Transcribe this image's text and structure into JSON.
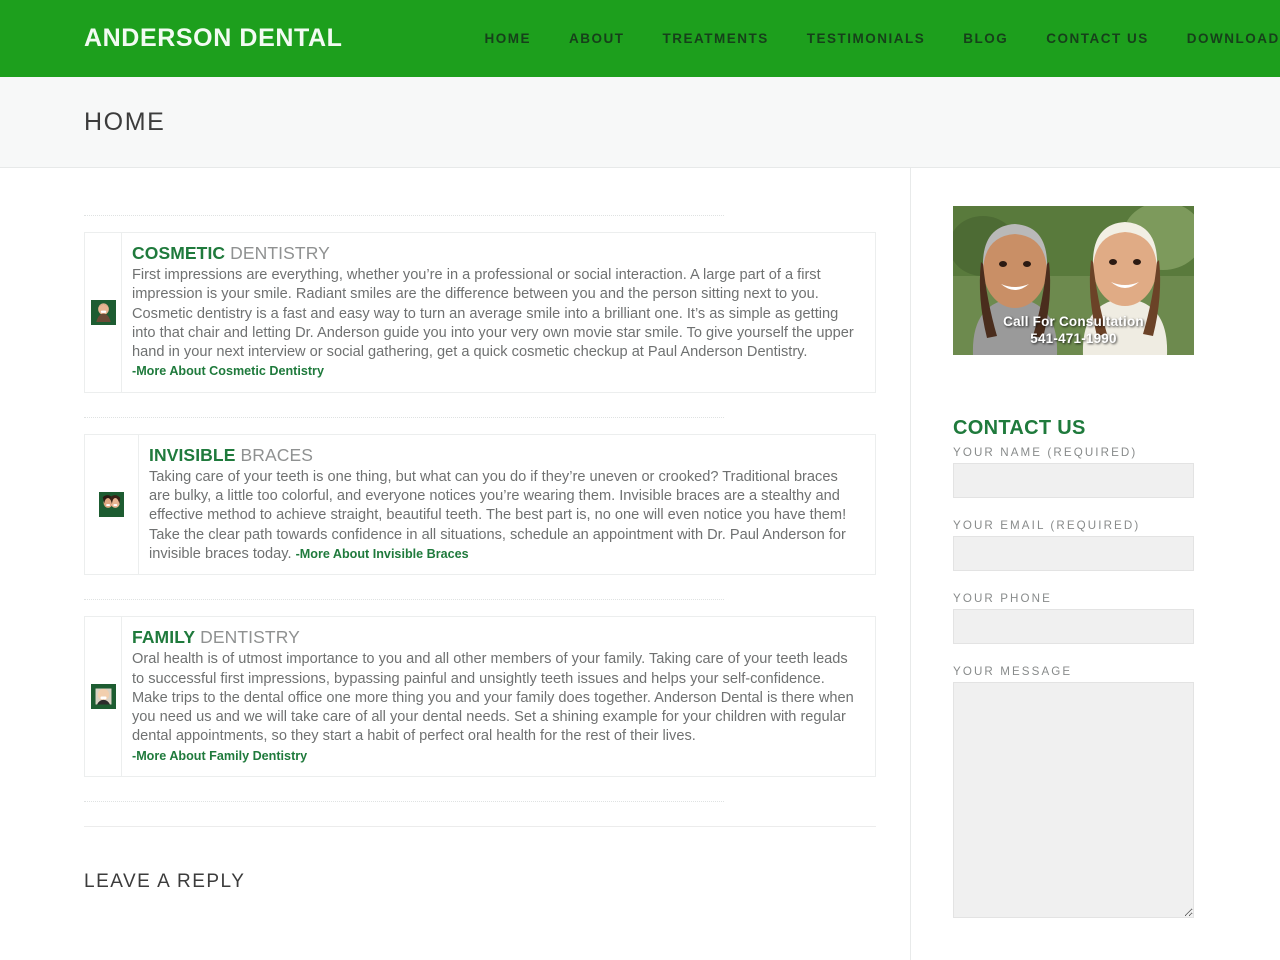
{
  "header": {
    "brand": "ANDERSON DENTAL",
    "brand_color": "#1d9f1d",
    "nav": [
      {
        "label": "HOME"
      },
      {
        "label": "ABOUT"
      },
      {
        "label": "TREATMENTS"
      },
      {
        "label": "TESTIMONIALS"
      },
      {
        "label": "BLOG"
      },
      {
        "label": "CONTACT US"
      },
      {
        "label": "DOWNLOADS"
      }
    ]
  },
  "page": {
    "title": "HOME",
    "accent_green": "#1f7a3c",
    "header_green": "#1d9f1d"
  },
  "services": [
    {
      "title_keyword": "COSMETIC",
      "title_rest": " DENTISTRY",
      "body": "First impressions are everything, whether you’re in a professional or social interaction.  A large part of a first impression is your smile.  Radiant smiles are the difference between you and the person sitting next to you.  Cosmetic dentistry is a fast and easy way to turn an average smile into a brilliant one.  It’s as simple as getting into that chair and letting Dr. Anderson guide you into your very own movie star smile.  To give yourself the upper hand in your next interview or social gathering, get a quick cosmetic checkup at Paul Anderson Dentistry.  ",
      "more_label": "-More About Cosmetic Dentistry",
      "thumb_name": "cosmetic-dentistry-thumbnail"
    },
    {
      "title_keyword": "INVISIBLE",
      "title_rest": " BRACES",
      "body": "Taking care of your teeth is one thing, but what can you do if they’re uneven or crooked?  Traditional braces are bulky, a little too colorful, and everyone notices you’re wearing them.  Invisible braces are a stealthy and effective method to achieve straight, beautiful teeth.  The best part is, no one will even notice you have them!  Take the clear path towards confidence in all situations, schedule an appointment with Dr. Paul Anderson for invisible braces today.  ",
      "more_label": "-More About Invisible Braces",
      "thumb_name": "invisible-braces-thumbnail"
    },
    {
      "title_keyword": "FAMILY",
      "title_rest": " DENTISTRY",
      "body": "Oral health is of utmost importance to you and all other members of your family. Taking care of your teeth leads to successful first impressions, bypassing painful and unsightly teeth issues and helps your self-confidence.  Make trips to the dental office one more thing you and your family does together. Anderson Dental is there when you need us and we will take care of all your dental needs.  Set a shining example for your children with regular dental appointments, so they start a habit of perfect oral health for the rest of their lives.  ",
      "more_label": "-More About Family Dentistry",
      "thumb_name": "family-dentistry-thumbnail"
    }
  ],
  "comments": {
    "leave_reply_heading": "LEAVE A REPLY"
  },
  "sidebar": {
    "promo": {
      "caption_line1": "Call For Consultation",
      "caption_line2": "541-471-1990",
      "name": "call-for-consultation-banner"
    },
    "contact_form": {
      "title": "CONTACT US",
      "fields": [
        {
          "label": "YOUR NAME (REQUIRED)",
          "value": "",
          "placeholder": "",
          "type": "text",
          "name": "your-name-field"
        },
        {
          "label": "YOUR EMAIL (REQUIRED)",
          "value": "",
          "placeholder": "",
          "type": "email",
          "name": "your-email-field"
        },
        {
          "label": "YOUR PHONE",
          "value": "",
          "placeholder": "",
          "type": "tel",
          "name": "your-phone-field"
        }
      ],
      "message": {
        "label": "YOUR MESSAGE",
        "value": "",
        "placeholder": "",
        "name": "your-message-field"
      }
    }
  }
}
